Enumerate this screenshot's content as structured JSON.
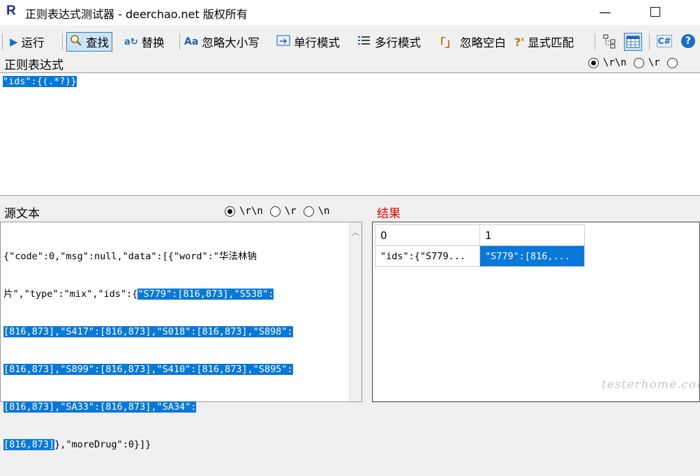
{
  "window": {
    "app_icon": "R",
    "title": "正则表达式测试器 - deerchao.net 版权所有",
    "minimize": "—",
    "maximize": ""
  },
  "toolbar": {
    "run": "运行",
    "find": "查找",
    "replace": "替换",
    "ignore_case": "忽略大小写",
    "single_line": "单行模式",
    "multi_line": "多行模式",
    "ignore_whitespace": "忽略空白",
    "explicit_capture": "显式匹配",
    "ignore_case_icon_text": "Aa",
    "ignore_ws_icon_text": "「」",
    "explicit_icon_text": "?'",
    "csharp_icon_text": "C#",
    "help_icon_text": "?"
  },
  "regex": {
    "label": "正则表达式",
    "newline_options": [
      "\\r\\n",
      "\\r",
      ""
    ],
    "selected_option": 0,
    "pattern": "\"ids\":{(.*?)}"
  },
  "source": {
    "label": "源文本",
    "newline_options": [
      "\\r\\n",
      "\\r",
      "\\n"
    ],
    "selected_option": 0,
    "lines": [
      {
        "plain": "{\"code\":0,\"msg\":null,\"data\":[{\"word\":\"华法林钠",
        "sel": "",
        "after": ""
      },
      {
        "plain": "片\",\"type\":\"mix\",\"ids\":{",
        "sel": "\"S779\":[816,873],\"S538\":",
        "after": ""
      },
      {
        "plain": "",
        "sel": "[816,873],\"S417\":[816,873],\"S018\":[816,873],\"S898\":",
        "after": ""
      },
      {
        "plain": "",
        "sel": "[816,873],\"S899\":[816,873],\"S410\":[816,873],\"S895\":",
        "after": ""
      },
      {
        "plain": "",
        "sel": "[816,873],\"SA33\":[816,873],\"SA34\":",
        "after": ""
      },
      {
        "plain": "",
        "sel": "[816,873]",
        "after": "},\"moreDrug\":0}]}"
      }
    ]
  },
  "result": {
    "label": "结果",
    "columns": [
      "0",
      "1"
    ],
    "rows": [
      [
        "\"ids\":{\"S779...",
        "\"S779\":[816,..."
      ]
    ]
  },
  "watermark": "testerhome.com",
  "colors": {
    "selection": "#0a78d7",
    "result_label": "#e00000",
    "app_icon": "#1f2a8c"
  }
}
